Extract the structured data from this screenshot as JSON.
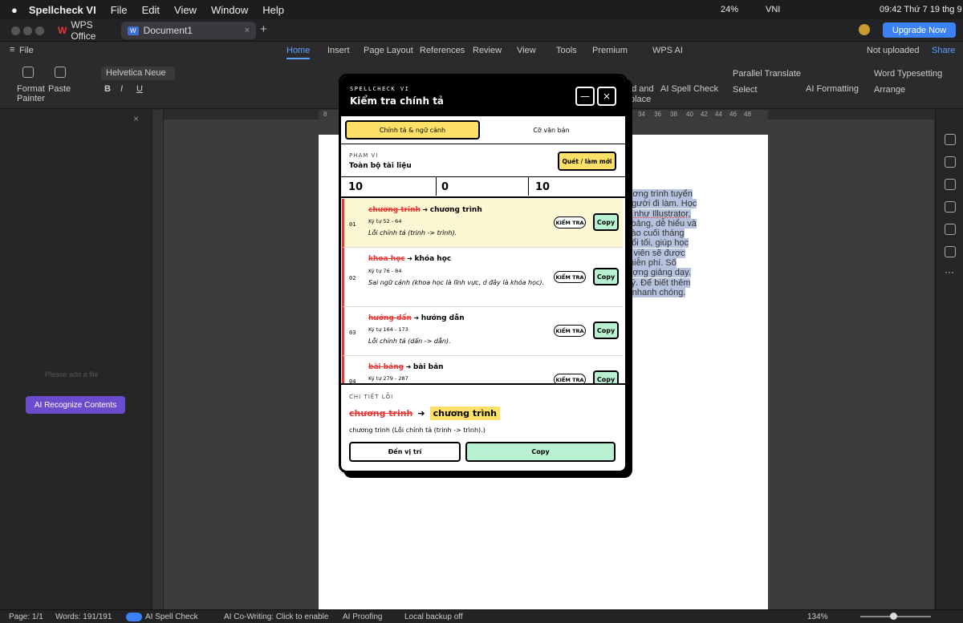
{
  "menubar": {
    "app_name": "Spellcheck VI",
    "items": [
      "File",
      "Edit",
      "View",
      "Window",
      "Help"
    ],
    "battery": "24%",
    "input_method": "VNI",
    "clock": "09:42 Thứ 7 19 thg 9"
  },
  "tabs": {
    "wps_label": "WPS Office",
    "doc_label": "Document1",
    "upgrade": "Upgrade Now"
  },
  "ribbon": {
    "file": "File",
    "tabs": [
      "Home",
      "Insert",
      "Page Layout",
      "References",
      "Review",
      "View",
      "Tools",
      "Premium",
      "WPS AI"
    ],
    "not_uploaded": "Not uploaded",
    "share": "Share"
  },
  "toolbar": {
    "format_painter_1": "Format",
    "format_painter_2": "Painter",
    "paste": "Paste",
    "font": "Helvetica Neue",
    "find_replace_1": "nd and",
    "find_replace_2": "place",
    "ai_spell": "AI Spell Check",
    "parallel": "Parallel Translate",
    "select": "Select",
    "ai_formatting": "AI Formatting",
    "word_typesetting": "Word Typesetting",
    "arrange": "Arrange"
  },
  "ruler_ticks": [
    "8",
    "34",
    "36",
    "38",
    "40",
    "42",
    "44",
    "46",
    "48"
  ],
  "leftpane": {
    "add_file": "Please add a file",
    "ai_recognize": "AI Recognize Contents"
  },
  "document_lines": [
    "ương trình tuyển",
    "người đi làm. Học",
    "g như Illustrator,",
    "i bảng, dễ hiểu và",
    "vào cuối tháng",
    "uổi tối, giúp học",
    "c viên sẽ được",
    "miễn phí. Số",
    "ượng giảng dạy.",
    "ký. Để biết thêm",
    "r nhanh chóng."
  ],
  "dialog": {
    "kicker": "SPELLCHECK VI",
    "title": "Kiểm tra chính tả",
    "min_icon": "—",
    "close_icon": "×",
    "tab_active": "Chính tả & ngữ cảnh",
    "tab_inactive": "Cỡ văn bản",
    "scope_label": "PHẠM VI",
    "scope_value": "Toàn bộ tài liệu",
    "scan_button": "Quét / làm mới",
    "stats": [
      "10",
      "0",
      "10"
    ],
    "kiem_tra": "KIỂM TRA",
    "copy": "Copy",
    "issues": [
      {
        "num": "01",
        "wrong": "chương trinh",
        "fix": "chương trình",
        "range": "Ký tự 52 - 64",
        "desc": "Lỗi chính tả (trinh -> trình)."
      },
      {
        "num": "02",
        "wrong": "khoa học",
        "fix": "khóa học",
        "range": "Ký tự 76 - 84",
        "desc": "Sai ngữ cảnh (khoa học là lĩnh vực, ở đây là khóa học)."
      },
      {
        "num": "03",
        "wrong": "hướng dẩn",
        "fix": "hướng dẫn",
        "range": "Ký tự 164 - 173",
        "desc": "Lỗi chính tả (dẩn -> dẫn)."
      },
      {
        "num": "04",
        "wrong": "bài bảng",
        "fix": "bài bản",
        "range": "Ký tự 279 - 287",
        "desc": ""
      }
    ],
    "detail_label": "CHI TIẾT LỖI",
    "detail_wrong": "chương trinh",
    "detail_fix": "chương trình",
    "detail_desc": "chương trinh (Lỗi chính tả (trinh -> trình).)",
    "goto_button": "Đến vị trí",
    "copy_button": "Copy"
  },
  "statusbar": {
    "page": "Page: 1/1",
    "words": "Words: 191/191",
    "ai_spell": "AI Spell Check",
    "ai_cowriting": "AI Co-Writing: Click to enable",
    "ai_proofing": "AI Proofing",
    "backup": "Local backup off",
    "zoom": "134%"
  },
  "colors": {
    "accent_blue": "#3b82f6",
    "yellow": "#fde068",
    "mint": "#b8f0d2",
    "error_red": "#e53935",
    "purple": "#6a4ccc"
  }
}
